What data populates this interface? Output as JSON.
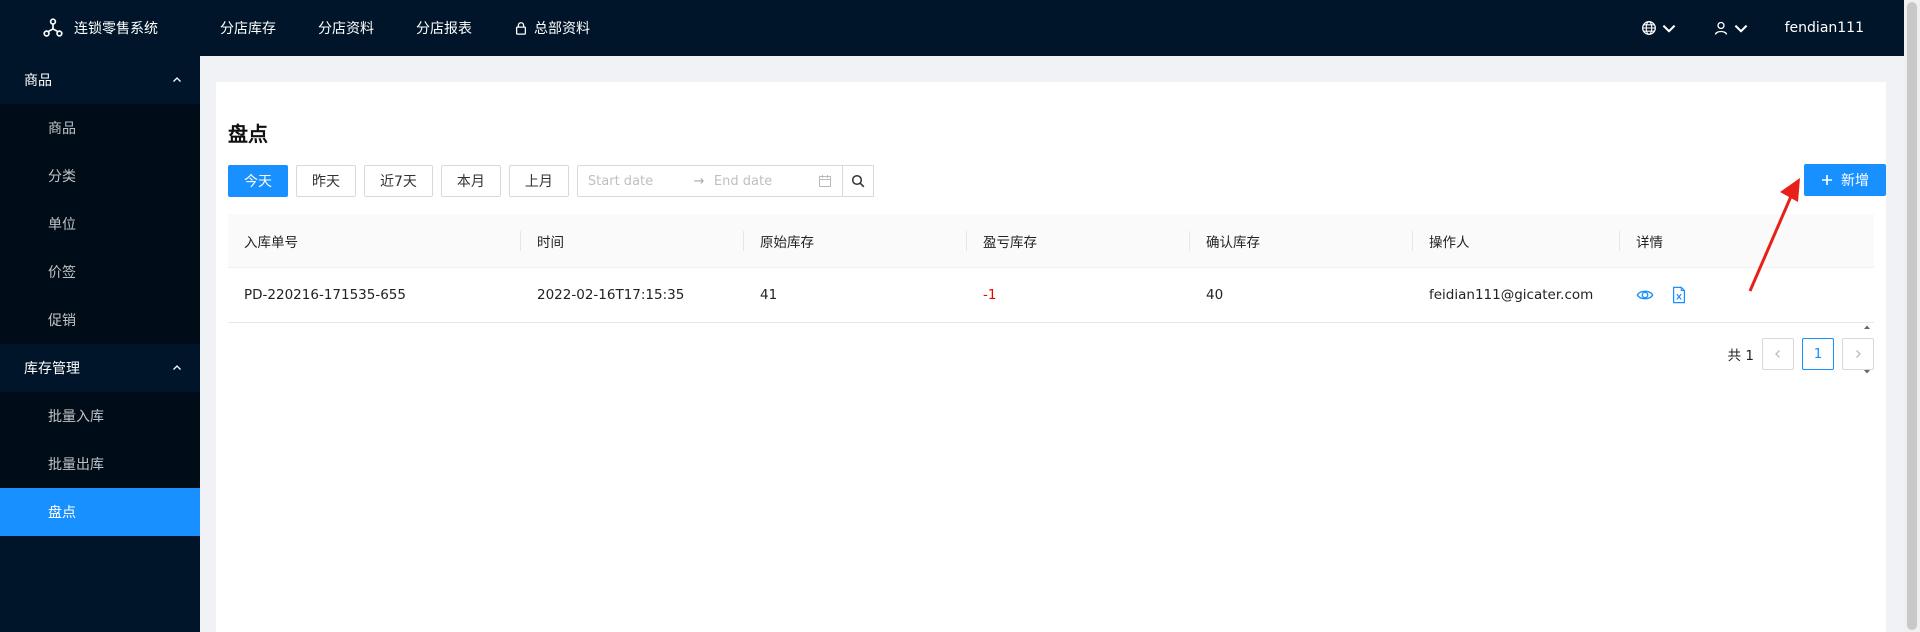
{
  "app": {
    "title": "连锁零售系统"
  },
  "topnav": [
    {
      "label": "分店库存"
    },
    {
      "label": "分店资料"
    },
    {
      "label": "分店报表"
    },
    {
      "label": "总部资料",
      "icon": "lock-icon"
    }
  ],
  "topright": {
    "username": "fendian111",
    "language_icon": "globe-icon",
    "user_icon": "user-icon"
  },
  "sidebar": {
    "groups": [
      {
        "label": "商品",
        "expanded": true,
        "items": [
          {
            "label": "商品"
          },
          {
            "label": "分类"
          },
          {
            "label": "单位"
          },
          {
            "label": "价签"
          },
          {
            "label": "促销"
          }
        ]
      },
      {
        "label": "库存管理",
        "expanded": true,
        "items": [
          {
            "label": "批量入库"
          },
          {
            "label": "批量出库"
          },
          {
            "label": "盘点",
            "active": true
          }
        ]
      }
    ]
  },
  "page": {
    "title": "盘点",
    "filters": {
      "today": "今天",
      "yesterday": "昨天",
      "last7": "近7天",
      "this_month": "本月",
      "last_month": "上月",
      "active": "今天"
    },
    "date_range": {
      "start_placeholder": "Start date",
      "end_placeholder": "End date",
      "separator": "→"
    },
    "add_button": "新增"
  },
  "table": {
    "columns": [
      "入库单号",
      "时间",
      "原始库存",
      "盈亏库存",
      "确认库存",
      "操作人",
      "详情"
    ],
    "rows": [
      {
        "id": "PD-220216-171535-655",
        "time": "2022-02-16T17:15:35",
        "original": "41",
        "diff": "-1",
        "confirmed": "40",
        "operator": "feidian111@gicater.com"
      }
    ]
  },
  "pagination": {
    "total_label": "共 1",
    "current": "1"
  },
  "colors": {
    "primary": "#1890ff",
    "nav_bg": "#001529",
    "submenu_bg": "#000c17",
    "negative": "#ee0000",
    "annotation": "#e8201a"
  }
}
